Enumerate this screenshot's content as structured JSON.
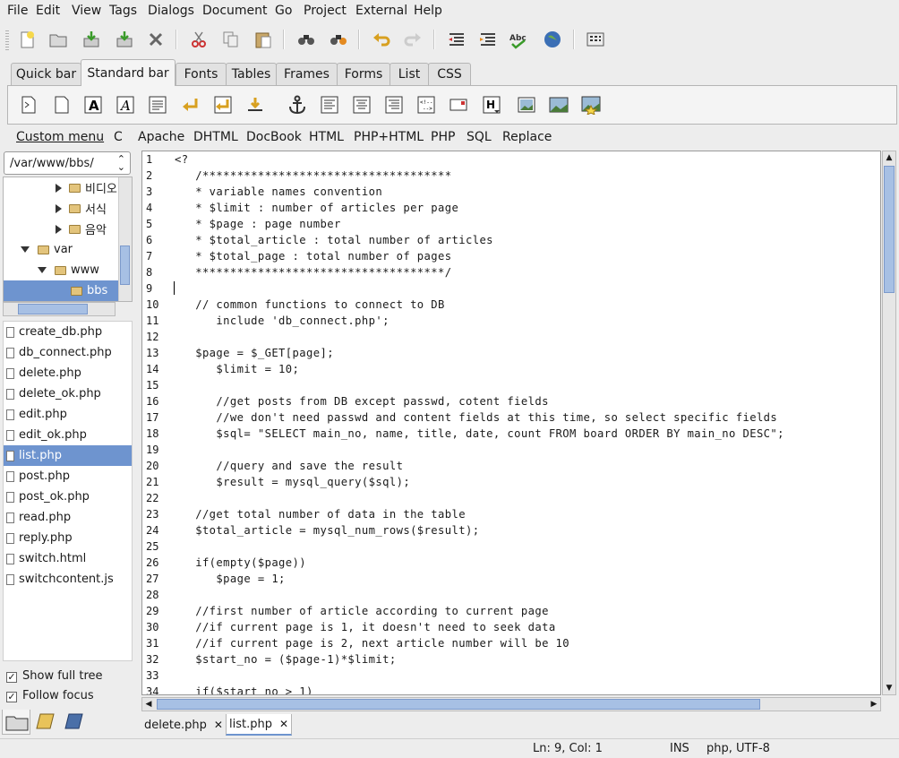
{
  "menubar": {
    "items": [
      "File",
      "Edit",
      "View",
      "Tags",
      "Dialogs",
      "Document",
      "Go",
      "Project",
      "External",
      "Help"
    ]
  },
  "toolbar": {
    "buttons": [
      "new-file",
      "open",
      "save",
      "save-as",
      "close",
      "cut",
      "copy",
      "paste",
      "find",
      "replace",
      "undo",
      "redo",
      "unindent",
      "indent",
      "spellcheck",
      "preview-browser",
      "character-map"
    ]
  },
  "tabs": {
    "items": [
      "Quick bar",
      "Standard bar",
      "Fonts",
      "Tables",
      "Frames",
      "Forms",
      "List",
      "CSS"
    ],
    "active": "Standard bar"
  },
  "custom_menu": {
    "items": [
      "Custom menu",
      "C",
      "Apache",
      "DHTML",
      "DocBook",
      "HTML",
      "PHP+HTML",
      "PHP",
      "SQL",
      "Replace"
    ]
  },
  "sidebar": {
    "path": "/var/www/bbs/",
    "tree": [
      {
        "label": "비디오",
        "depth": 2,
        "expanded": false
      },
      {
        "label": "서식",
        "depth": 2,
        "expanded": false
      },
      {
        "label": "음악",
        "depth": 2,
        "expanded": false
      },
      {
        "label": "var",
        "depth": 1,
        "expanded": true
      },
      {
        "label": "www",
        "depth": 2,
        "expanded": true
      },
      {
        "label": "bbs",
        "depth": 3,
        "selected": true
      }
    ],
    "files": [
      "create_db.php",
      "db_connect.php",
      "delete.php",
      "delete_ok.php",
      "edit.php",
      "edit_ok.php",
      "list.php",
      "post.php",
      "post_ok.php",
      "read.php",
      "reply.php",
      "switch.html",
      "switchcontent.js"
    ],
    "selected_file": "list.php",
    "show_full_tree": "Show full tree",
    "follow_focus": "Follow focus"
  },
  "editor": {
    "line_numbers": [
      "1",
      "2",
      "3",
      "4",
      "5",
      "6",
      "7",
      "8",
      "9",
      "10",
      "11",
      "12",
      "13",
      "14",
      "15",
      "16",
      "17",
      "18",
      "19",
      "20",
      "21",
      "22",
      "23",
      "24",
      "25",
      "26",
      "27",
      "28",
      "29",
      "30",
      "31",
      "32",
      "33",
      "34"
    ],
    "lines": [
      "<?",
      "   /************************************",
      "   * variable names convention",
      "   * $limit : number of articles per page",
      "   * $page : page number",
      "   * $total_article : total number of articles",
      "   * $total_page : total number of pages",
      "   ************************************/",
      "",
      "   // common functions to connect to DB",
      "      include 'db_connect.php';",
      "",
      "   $page = $_GET[page];",
      "      $limit = 10;",
      "",
      "      //get posts from DB except passwd, cotent fields",
      "      //we don't need passwd and content fields at this time, so select specific fields",
      "      $sql= \"SELECT main_no, name, title, date, count FROM board ORDER BY main_no DESC\";",
      "",
      "      //query and save the result",
      "      $result = mysql_query($sql);",
      "",
      "   //get total number of data in the table",
      "   $total_article = mysql_num_rows($result);",
      "",
      "   if(empty($page))",
      "      $page = 1;",
      "",
      "   //first number of article according to current page",
      "   //if current page is 1, it doesn't need to seek data",
      "   //if current page is 2, next article number will be 10",
      "   $start_no = ($page-1)*$limit;",
      "",
      "   if($start_no > 1)"
    ]
  },
  "document_tabs": [
    "delete.php",
    "list.php"
  ],
  "active_document": "list.php",
  "status": {
    "position": "Ln: 9, Col: 1",
    "mode": "INS",
    "encoding": "php, UTF-8"
  }
}
